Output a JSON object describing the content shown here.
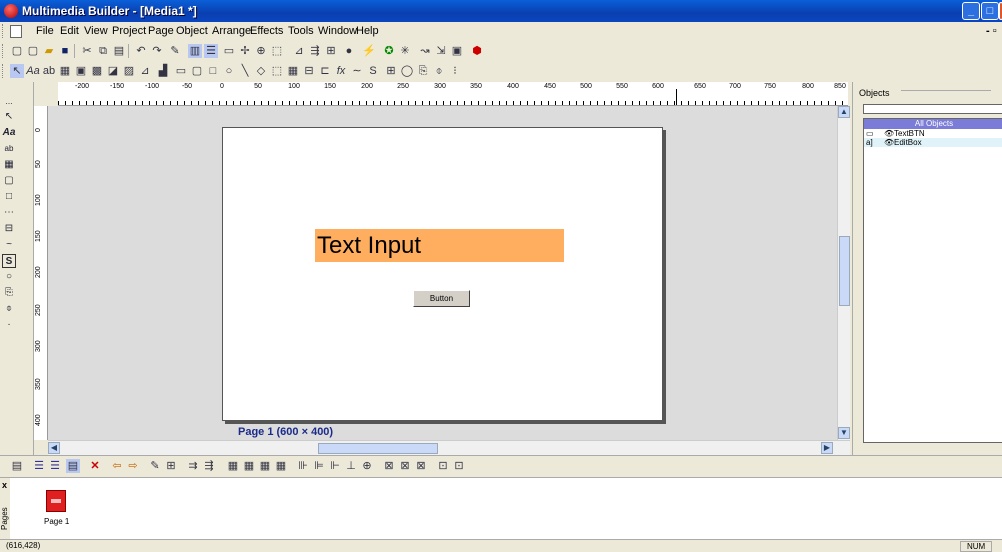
{
  "window": {
    "title": "Multimedia Builder - [Media1 *]",
    "min": "_",
    "max": "□",
    "close": "X",
    "mdi_controls": "- ▫"
  },
  "menu": [
    "File",
    "Edit",
    "View",
    "Project",
    "Page",
    "Object",
    "Arrange",
    "Effects",
    "Tools",
    "Window",
    "Help"
  ],
  "ruler": {
    "labels": [
      "-200",
      "-150",
      "-100",
      "-50",
      "0",
      "50",
      "100",
      "150",
      "200",
      "250",
      "300",
      "350",
      "400",
      "450",
      "500",
      "550",
      "600",
      "650",
      "700",
      "750",
      "800",
      "850"
    ]
  },
  "vruler": {
    "labels": [
      "0",
      "50",
      "100",
      "150",
      "200",
      "250",
      "300",
      "350",
      "400"
    ]
  },
  "canvas": {
    "text_input": "Text Input",
    "button_label": "Button",
    "page_label": "Page 1 (600 × 400)"
  },
  "objects": {
    "header": "Objects",
    "all_label": "All Objects",
    "items": [
      {
        "icon": "▭",
        "name": "TextBTN"
      },
      {
        "icon": "a]",
        "name": "EditBox"
      }
    ]
  },
  "pages": {
    "side_label": "Pages",
    "close": "x",
    "items": [
      {
        "name": "Page 1"
      }
    ]
  },
  "status": {
    "coords": "(616,428)",
    "num": "NUM"
  },
  "tools_left": [
    "↖",
    "Aa",
    "ab",
    "▦",
    "▢",
    "□",
    "⋯",
    "⊟",
    "~",
    "S",
    "○",
    "⎘",
    "⌽",
    "·"
  ]
}
